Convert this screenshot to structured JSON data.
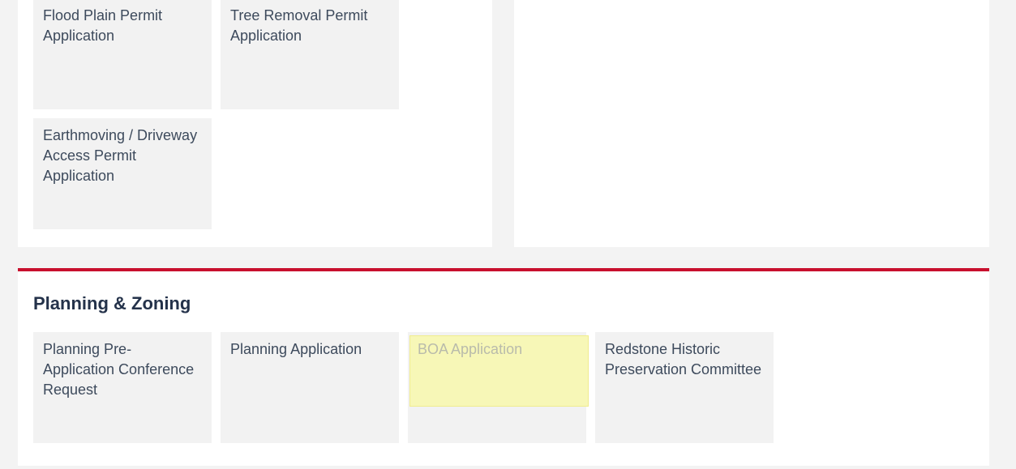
{
  "permits": {
    "tiles": [
      "Flood Plain Permit Application",
      "Tree Removal Permit Application",
      "Earthmoving / Driveway Access Permit Application"
    ]
  },
  "planning": {
    "title": "Planning & Zoning",
    "tiles": [
      "Planning Pre-Application Conference Request",
      "Planning Application",
      "BOA Application",
      "Redstone Historic Preservation Committee"
    ],
    "highlight_color": "#f7f7b7",
    "accent_color": "#c8102e"
  }
}
